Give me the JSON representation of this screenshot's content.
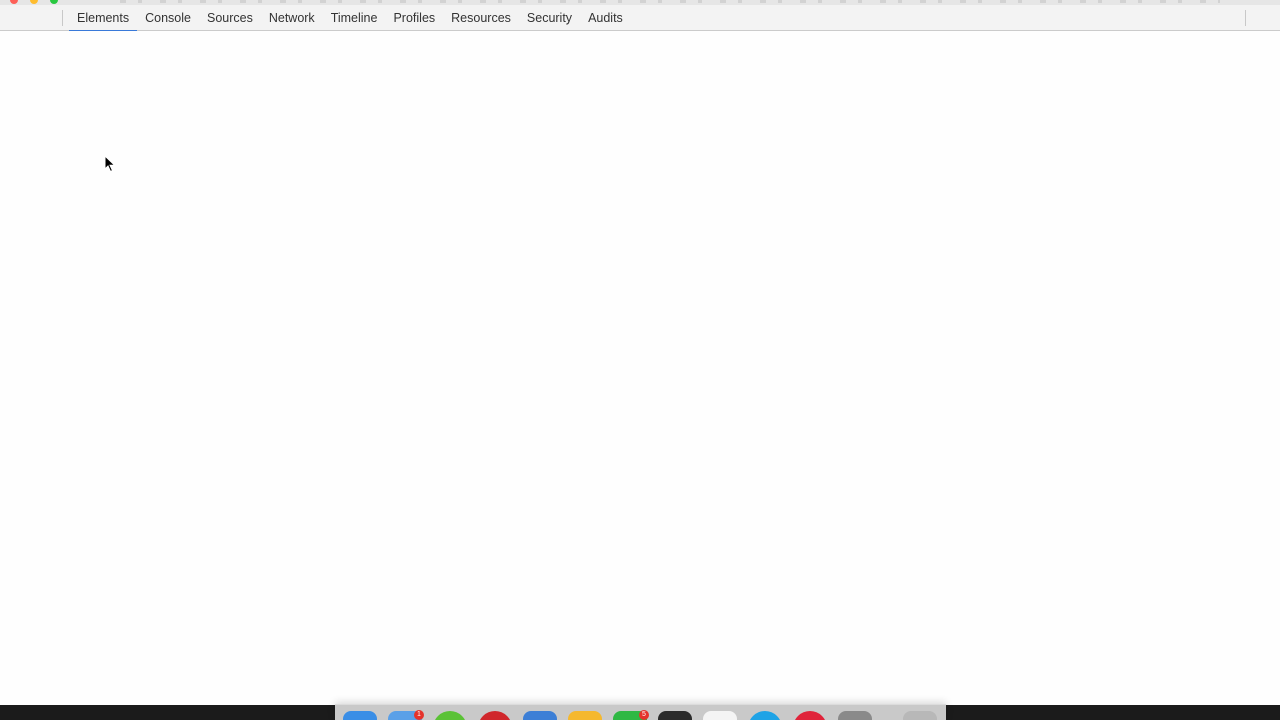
{
  "devtools": {
    "tabs": [
      {
        "label": "Elements",
        "selected": true
      },
      {
        "label": "Console",
        "selected": false
      },
      {
        "label": "Sources",
        "selected": false
      },
      {
        "label": "Network",
        "selected": false
      },
      {
        "label": "Timeline",
        "selected": false
      },
      {
        "label": "Profiles",
        "selected": false
      },
      {
        "label": "Resources",
        "selected": false
      },
      {
        "label": "Security",
        "selected": false
      },
      {
        "label": "Audits",
        "selected": false
      }
    ],
    "accent_color": "#3879d9"
  },
  "dock": {
    "apps": [
      {
        "icon": "finder-icon",
        "color": "#3a8ee6"
      },
      {
        "icon": "mail-icon",
        "color": "#5aa0e8",
        "badge": "1"
      },
      {
        "icon": "messages-icon",
        "color": "#5bc236"
      },
      {
        "icon": "opera-icon",
        "color": "#d0272c"
      },
      {
        "icon": "xcode-icon",
        "color": "#3d7fd6"
      },
      {
        "icon": "sketch-icon",
        "color": "#f5b82e"
      },
      {
        "icon": "facetime-icon",
        "color": "#2fb844",
        "badge": "5"
      },
      {
        "icon": "terminal-icon",
        "color": "#2b2b2b"
      },
      {
        "icon": "notes-icon",
        "color": "#f4f4f4"
      },
      {
        "icon": "skype-icon",
        "color": "#1fa3e6"
      },
      {
        "icon": "record-icon",
        "color": "#e0233a"
      },
      {
        "icon": "film-icon",
        "color": "#8a8a8a"
      },
      {
        "icon": "trash-icon",
        "color": "#b8b8b8"
      }
    ]
  }
}
